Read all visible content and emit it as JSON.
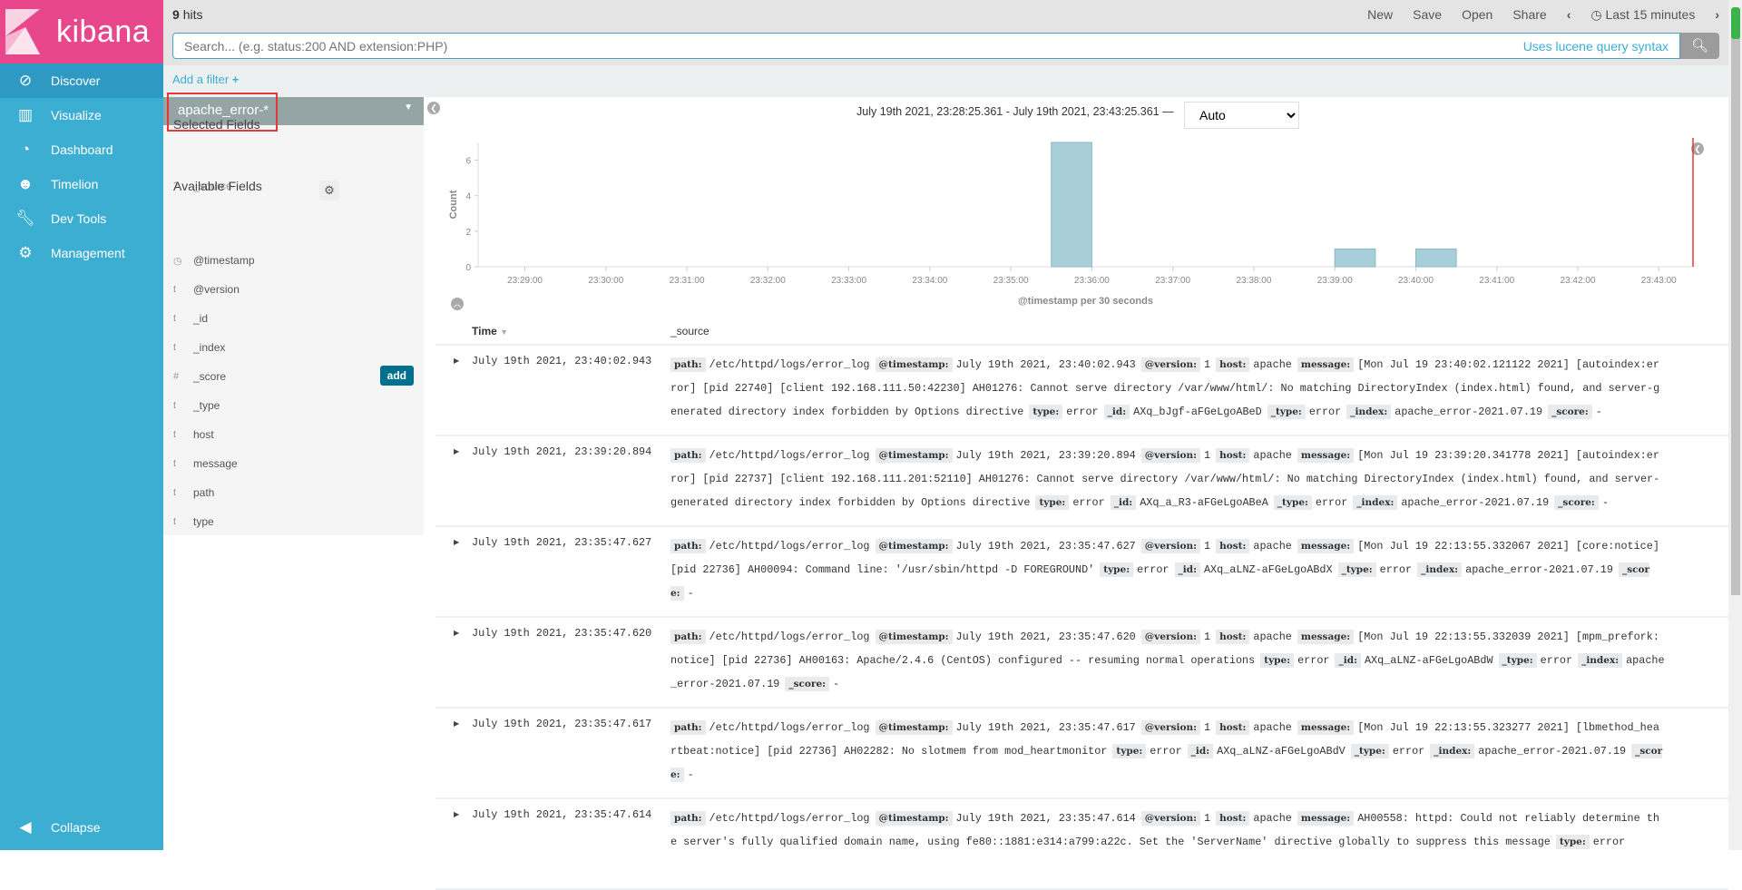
{
  "app": {
    "logo_text": "kibana",
    "brand_color": "#e8488b",
    "sidebar_color": "#3caed2"
  },
  "sidebar": {
    "items": [
      {
        "label": "Discover",
        "icon": "compass-icon",
        "active": true
      },
      {
        "label": "Visualize",
        "icon": "bar-chart-icon"
      },
      {
        "label": "Dashboard",
        "icon": "dashboard-icon"
      },
      {
        "label": "Timelion",
        "icon": "timelion-icon"
      },
      {
        "label": "Dev Tools",
        "icon": "wrench-icon"
      },
      {
        "label": "Management",
        "icon": "gear-icon"
      }
    ],
    "collapse": "Collapse"
  },
  "header": {
    "hits_count": "9",
    "hits_label": "hits",
    "new": "New",
    "save": "Save",
    "open": "Open",
    "share": "Share",
    "time_range": "Last 15 minutes"
  },
  "search": {
    "placeholder": "Search... (e.g. status:200 AND extension:PHP)",
    "value": "",
    "hint": "Uses lucene query syntax"
  },
  "filter": {
    "add_label": "Add a filter"
  },
  "fields": {
    "index_pattern": "apache_error-*",
    "selected_heading": "Selected Fields",
    "selected": [
      {
        "type": "?",
        "name": "_source"
      }
    ],
    "available_heading": "Available Fields",
    "available": [
      {
        "type": "◷",
        "name": "@timestamp"
      },
      {
        "type": "t",
        "name": "@version"
      },
      {
        "type": "t",
        "name": "_id"
      },
      {
        "type": "t",
        "name": "_index"
      },
      {
        "type": "#",
        "name": "_score"
      },
      {
        "type": "t",
        "name": "_type"
      },
      {
        "type": "t",
        "name": "host"
      },
      {
        "type": "t",
        "name": "message"
      },
      {
        "type": "t",
        "name": "path"
      },
      {
        "type": "t",
        "name": "type"
      }
    ],
    "add_button": "add"
  },
  "histogram": {
    "range_text": "July 19th 2021, 23:28:25.361 - July 19th 2021, 23:43:25.361 —",
    "interval": "Auto"
  },
  "chart_data": {
    "type": "bar",
    "xlabel": "@timestamp per 30 seconds",
    "ylabel": "Count",
    "x_range": [
      "23:28:25.361",
      "23:43:25.361"
    ],
    "ylim": [
      0,
      7
    ],
    "x_ticks": [
      "23:29:00",
      "23:30:00",
      "23:31:00",
      "23:32:00",
      "23:33:00",
      "23:34:00",
      "23:35:00",
      "23:36:00",
      "23:37:00",
      "23:38:00",
      "23:39:00",
      "23:40:00",
      "23:41:00",
      "23:42:00",
      "23:43:00"
    ],
    "y_ticks": [
      0,
      2,
      4,
      6
    ],
    "bars": [
      {
        "x": "23:35:30",
        "value": 7
      },
      {
        "x": "23:39:00",
        "value": 1
      },
      {
        "x": "23:40:00",
        "value": 1
      }
    ],
    "bar_color": "#a8cfd9",
    "now_marker": "23:43:25.361",
    "now_color": "#e53935"
  },
  "table": {
    "col_time": "Time",
    "col_source": "_source",
    "rows": [
      {
        "time": "July 19th 2021, 23:40:02.943",
        "fields": [
          {
            "k": "path:",
            "v": "/etc/httpd/logs/error_log"
          },
          {
            "k": "@timestamp:",
            "v": "July 19th 2021, 23:40:02.943"
          },
          {
            "k": "@version:",
            "v": "1"
          },
          {
            "k": "host:",
            "v": "apache"
          },
          {
            "k": "message:",
            "v": "[Mon Jul 19 23:40:02.121122 2021] [autoindex:error] [pid 22740] [client 192.168.111.50:42230] AH01276: Cannot serve directory /var/www/html/: No matching DirectoryIndex (index.html) found, and server-generated directory index forbidden by Options directive"
          },
          {
            "k": "type:",
            "v": "error"
          },
          {
            "k": "_id:",
            "v": "AXq_bJgf-aFGeLgoABeD"
          },
          {
            "k": "_type:",
            "v": "error"
          },
          {
            "k": "_index:",
            "v": "apache_error-2021.07.19"
          },
          {
            "k": "_score:",
            "v": "-"
          }
        ]
      },
      {
        "time": "July 19th 2021, 23:39:20.894",
        "fields": [
          {
            "k": "path:",
            "v": "/etc/httpd/logs/error_log"
          },
          {
            "k": "@timestamp:",
            "v": "July 19th 2021, 23:39:20.894"
          },
          {
            "k": "@version:",
            "v": "1"
          },
          {
            "k": "host:",
            "v": "apache"
          },
          {
            "k": "message:",
            "v": "[Mon Jul 19 23:39:20.341778 2021] [autoindex:error] [pid 22737] [client 192.168.111.201:52110] AH01276: Cannot serve directory /var/www/html/: No matching DirectoryIndex (index.html) found, and server-generated directory index forbidden by Options directive"
          },
          {
            "k": "type:",
            "v": "error"
          },
          {
            "k": "_id:",
            "v": "AXq_a_R3-aFGeLgoABeA"
          },
          {
            "k": "_type:",
            "v": "error"
          },
          {
            "k": "_index:",
            "v": "apache_error-2021.07.19"
          },
          {
            "k": "_score:",
            "v": "-"
          }
        ]
      },
      {
        "time": "July 19th 2021, 23:35:47.627",
        "fields": [
          {
            "k": "path:",
            "v": "/etc/httpd/logs/error_log"
          },
          {
            "k": "@timestamp:",
            "v": "July 19th 2021, 23:35:47.627"
          },
          {
            "k": "@version:",
            "v": "1"
          },
          {
            "k": "host:",
            "v": "apache"
          },
          {
            "k": "message:",
            "v": "[Mon Jul 19 22:13:55.332067 2021] [core:notice] [pid 22736] AH00094: Command line: '/usr/sbin/httpd -D FOREGROUND'"
          },
          {
            "k": "type:",
            "v": "error"
          },
          {
            "k": "_id:",
            "v": "AXq_aLNZ-aFGeLgoABdX"
          },
          {
            "k": "_type:",
            "v": "error"
          },
          {
            "k": "_index:",
            "v": "apache_error-2021.07.19"
          },
          {
            "k": "_score:",
            "v": "-"
          }
        ]
      },
      {
        "time": "July 19th 2021, 23:35:47.620",
        "fields": [
          {
            "k": "path:",
            "v": "/etc/httpd/logs/error_log"
          },
          {
            "k": "@timestamp:",
            "v": "July 19th 2021, 23:35:47.620"
          },
          {
            "k": "@version:",
            "v": "1"
          },
          {
            "k": "host:",
            "v": "apache"
          },
          {
            "k": "message:",
            "v": "[Mon Jul 19 22:13:55.332039 2021] [mpm_prefork:notice] [pid 22736] AH00163: Apache/2.4.6 (CentOS) configured -- resuming normal operations"
          },
          {
            "k": "type:",
            "v": "error"
          },
          {
            "k": "_id:",
            "v": "AXq_aLNZ-aFGeLgoABdW"
          },
          {
            "k": "_type:",
            "v": "error"
          },
          {
            "k": "_index:",
            "v": "apache_error-2021.07.19"
          },
          {
            "k": "_score:",
            "v": "-"
          }
        ]
      },
      {
        "time": "July 19th 2021, 23:35:47.617",
        "fields": [
          {
            "k": "path:",
            "v": "/etc/httpd/logs/error_log"
          },
          {
            "k": "@timestamp:",
            "v": "July 19th 2021, 23:35:47.617"
          },
          {
            "k": "@version:",
            "v": "1"
          },
          {
            "k": "host:",
            "v": "apache"
          },
          {
            "k": "message:",
            "v": "[Mon Jul 19 22:13:55.323277 2021] [lbmethod_heartbeat:notice] [pid 22736] AH02282: No slotmem from mod_heartmonitor"
          },
          {
            "k": "type:",
            "v": "error"
          },
          {
            "k": "_id:",
            "v": "AXq_aLNZ-aFGeLgoABdV"
          },
          {
            "k": "_type:",
            "v": "error"
          },
          {
            "k": "_index:",
            "v": "apache_error-2021.07.19"
          },
          {
            "k": "_score:",
            "v": "-"
          }
        ]
      },
      {
        "time": "July 19th 2021, 23:35:47.614",
        "fields": [
          {
            "k": "path:",
            "v": "/etc/httpd/logs/error_log"
          },
          {
            "k": "@timestamp:",
            "v": "July 19th 2021, 23:35:47.614"
          },
          {
            "k": "@version:",
            "v": "1"
          },
          {
            "k": "host:",
            "v": "apache"
          },
          {
            "k": "message:",
            "v": "AH00558: httpd: Could not reliably determine the server's fully qualified domain name, using fe80::1881:e314:a799:a22c. Set the 'ServerName' directive globally to suppress this message"
          },
          {
            "k": "type:",
            "v": "error"
          }
        ]
      }
    ]
  }
}
